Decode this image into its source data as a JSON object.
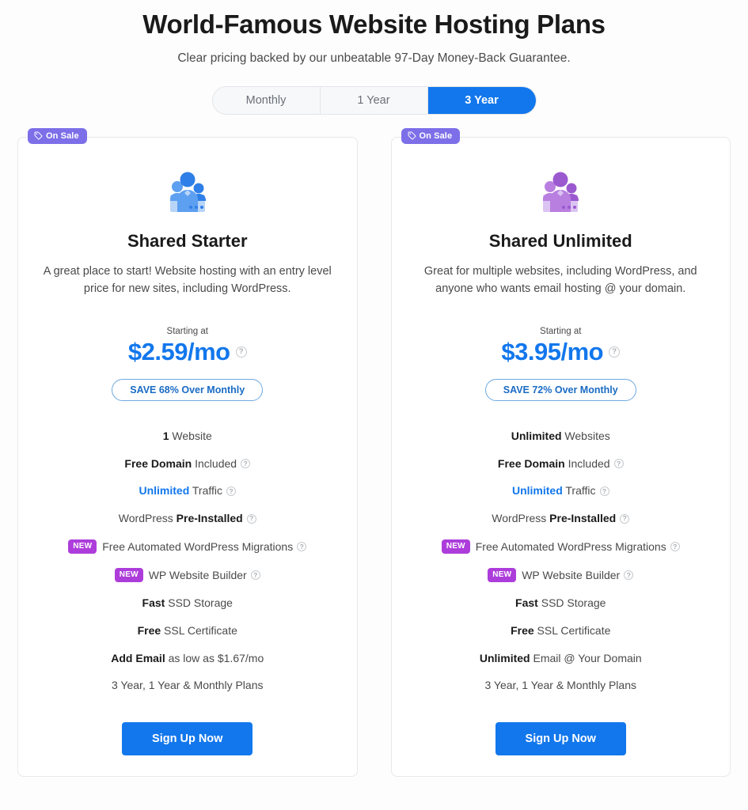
{
  "header": {
    "title": "World-Famous Website Hosting Plans",
    "subtitle": "Clear pricing backed by our unbeatable 97-Day Money-Back Guarantee."
  },
  "billing_toggle": {
    "options": [
      {
        "label": "Monthly",
        "active": false
      },
      {
        "label": "1 Year",
        "active": false
      },
      {
        "label": "3 Year",
        "active": true
      }
    ],
    "selected": "3 Year"
  },
  "colors": {
    "accent_blue": "#1277ec",
    "sale_purple": "#7c6fe8",
    "new_purple": "#ad3ddb",
    "save_border": "#6ea8e0",
    "card_border": "#e6e8eb"
  },
  "plans": [
    {
      "badge": "On Sale",
      "icon": "group-people-icon",
      "icon_color": "blue",
      "name": "Shared Starter",
      "description": "A great place to start! Website hosting with an entry level price for new sites, including WordPress.",
      "price_label": "Starting at",
      "price": "$2.59/mo",
      "price_help": "?",
      "save_text": "SAVE 68% Over Monthly",
      "features": [
        {
          "strong": "1",
          "text": " Website",
          "help": false,
          "new": false,
          "blue": false
        },
        {
          "strong": "Free Domain",
          "text": " Included",
          "help": true,
          "new": false,
          "blue": false
        },
        {
          "strong": "Unlimited",
          "text": " Traffic",
          "help": true,
          "new": false,
          "blue": true
        },
        {
          "strong": "",
          "text": "WordPress ",
          "strong_after": "Pre-Installed",
          "help": true,
          "new": false,
          "blue": false
        },
        {
          "strong": "",
          "text": "Free Automated WordPress Migrations",
          "help": true,
          "new": true,
          "blue": false
        },
        {
          "strong": "",
          "text": "WP Website Builder",
          "help": true,
          "new": true,
          "blue": false
        },
        {
          "strong": "Fast",
          "text": " SSD Storage",
          "help": false,
          "new": false,
          "blue": false
        },
        {
          "strong": "Free",
          "text": " SSL Certificate",
          "help": false,
          "new": false,
          "blue": false
        },
        {
          "strong": "Add Email",
          "text": " as low as $1.67/mo",
          "help": false,
          "new": false,
          "blue": false
        },
        {
          "strong": "",
          "text": "3 Year, 1 Year & Monthly Plans",
          "help": false,
          "new": false,
          "blue": false
        }
      ],
      "cta": "Sign Up Now"
    },
    {
      "badge": "On Sale",
      "icon": "group-people-icon",
      "icon_color": "purple",
      "name": "Shared Unlimited",
      "description": "Great for multiple websites, including WordPress, and anyone who wants email hosting @ your domain.",
      "price_label": "Starting at",
      "price": "$3.95/mo",
      "price_help": "?",
      "save_text": "SAVE 72% Over Monthly",
      "features": [
        {
          "strong": "Unlimited",
          "text": " Websites",
          "help": false,
          "new": false,
          "blue": false
        },
        {
          "strong": "Free Domain",
          "text": " Included",
          "help": true,
          "new": false,
          "blue": false
        },
        {
          "strong": "Unlimited",
          "text": " Traffic",
          "help": true,
          "new": false,
          "blue": true
        },
        {
          "strong": "",
          "text": "WordPress ",
          "strong_after": "Pre-Installed",
          "help": true,
          "new": false,
          "blue": false
        },
        {
          "strong": "",
          "text": "Free Automated WordPress Migrations",
          "help": true,
          "new": true,
          "blue": false
        },
        {
          "strong": "",
          "text": "WP Website Builder",
          "help": true,
          "new": true,
          "blue": false
        },
        {
          "strong": "Fast",
          "text": " SSD Storage",
          "help": false,
          "new": false,
          "blue": false
        },
        {
          "strong": "Free",
          "text": " SSL Certificate",
          "help": false,
          "new": false,
          "blue": false
        },
        {
          "strong": "Unlimited",
          "text": " Email @ Your Domain",
          "help": false,
          "new": false,
          "blue": false
        },
        {
          "strong": "",
          "text": "3 Year, 1 Year & Monthly Plans",
          "help": false,
          "new": false,
          "blue": false
        }
      ],
      "cta": "Sign Up Now"
    }
  ]
}
